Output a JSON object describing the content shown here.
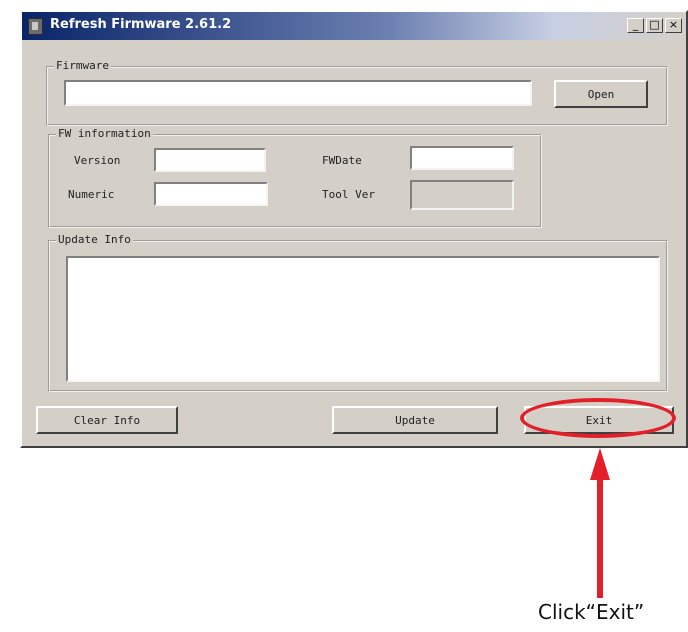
{
  "window": {
    "title": "Refresh Firmware 2.61.2",
    "controls": {
      "minimize": "_",
      "maximize": "□",
      "close": "×"
    }
  },
  "firmware": {
    "group_label": "Firmware",
    "path_value": "",
    "open_label": "Open"
  },
  "fw_info": {
    "group_label": "FW information",
    "version_label": "Version",
    "version_value": "",
    "fwdate_label": "FWDate",
    "fwdate_value": "",
    "numeric_label": "Numeric",
    "numeric_value": "",
    "toolver_label": "Tool Ver",
    "toolver_value": ""
  },
  "update_info": {
    "group_label": "Update Info",
    "text": ""
  },
  "buttons": {
    "clear_info": "Clear Info",
    "update": "Update",
    "exit": "Exit"
  },
  "annotation": {
    "caption": "Click“Exit”",
    "color": "#e3202a"
  }
}
